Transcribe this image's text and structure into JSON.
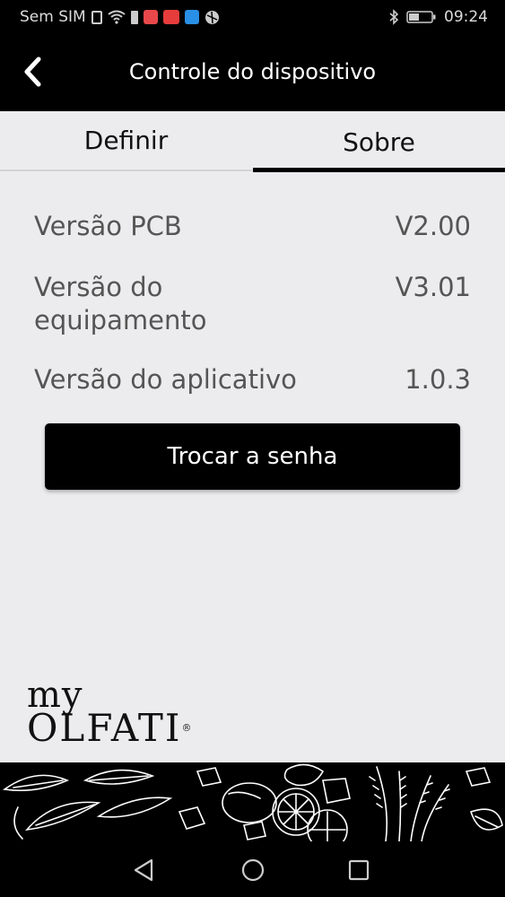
{
  "status_bar": {
    "carrier": "Sem SIM",
    "time": "09:24"
  },
  "header": {
    "title": "Controle do dispositivo"
  },
  "tabs": [
    {
      "label": "Definir"
    },
    {
      "label": "Sobre"
    }
  ],
  "about": {
    "rows": [
      {
        "label": "Versão PCB",
        "value": "V2.00"
      },
      {
        "label": "Versão do equipamento",
        "value": "V3.01"
      },
      {
        "label": "Versão do aplicativo",
        "value": "1.0.3"
      }
    ],
    "change_password_label": "Trocar a senha"
  },
  "brand": {
    "line1": "my",
    "line2": "OLFATI",
    "registered": "®"
  },
  "icons": {
    "back": "chevron-left-icon",
    "nav": [
      "back-triangle-icon",
      "home-circle-icon",
      "recents-square-icon"
    ]
  }
}
